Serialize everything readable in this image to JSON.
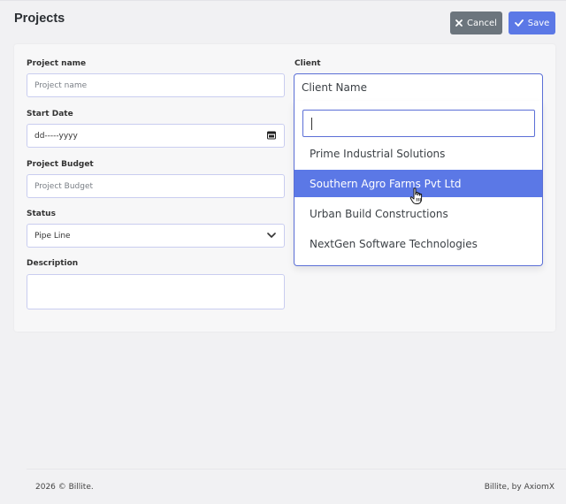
{
  "page": {
    "title": "Projects"
  },
  "toolbar": {
    "cancel_label": "Cancel",
    "save_label": "Save"
  },
  "form": {
    "project_name": {
      "label": "Project name",
      "placeholder": "Project name"
    },
    "start_date": {
      "label": "Start Date",
      "placeholder": "dd-----yyyy"
    },
    "project_budget": {
      "label": "Project Budget",
      "placeholder": "Project Budget"
    },
    "status": {
      "label": "Status",
      "value": "Pipe Line"
    },
    "description": {
      "label": "Description",
      "value": ""
    },
    "client": {
      "label": "Client",
      "value": "Client Name",
      "search_value": "",
      "options": [
        {
          "label": "Prime Industrial Solutions",
          "selected": false
        },
        {
          "label": "Southern Agro Farms Pvt Ltd",
          "selected": true
        },
        {
          "label": "Urban Build Constructions",
          "selected": false
        },
        {
          "label": "NextGen Software Technologies",
          "selected": false
        }
      ]
    }
  },
  "footer": {
    "copyright": "2026 © Billite.",
    "credit": "Billite, by AxiomX"
  },
  "colors": {
    "primary": "#5b78e6",
    "secondary": "#6c757d",
    "border": "#c9cdf0"
  },
  "icons": {
    "cancel": "close-icon",
    "save": "check-icon",
    "calendar": "calendar-icon",
    "status": "chevron-down-icon",
    "cursor": "hand-pointer-icon"
  }
}
